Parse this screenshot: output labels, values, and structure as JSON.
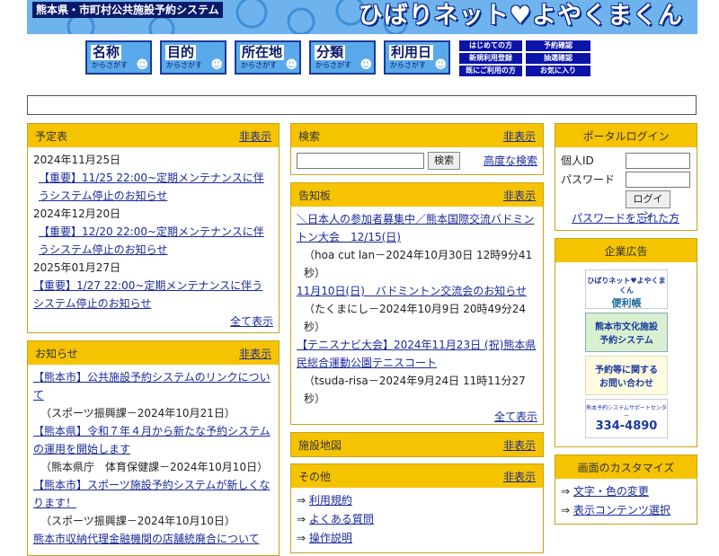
{
  "header": {
    "system_name": "熊本県・市町村公共施設予約システム",
    "brand": "ひばりネット♥よやくまくん",
    "search_buttons": [
      {
        "label": "名称",
        "sub": "からさがす"
      },
      {
        "label": "目的",
        "sub": "からさがす"
      },
      {
        "label": "所在地",
        "sub": "からさがす"
      },
      {
        "label": "分類",
        "sub": "からさがす"
      },
      {
        "label": "利用日",
        "sub": "からさがす"
      }
    ],
    "menu_buttons": [
      "はじめての方",
      "予約確認",
      "新規利用登録",
      "抽選確認",
      "既にご利用の方",
      "お気に入り"
    ]
  },
  "schedule": {
    "title": "予定表",
    "hide": "非表示",
    "entries": [
      {
        "date": "2024年11月25日",
        "text": "【重要】11/25 22:00~定期メンテナンスに伴うシステム停止のお知らせ"
      },
      {
        "date": "2024年12月20日",
        "text": "【重要】12/20 22:00~定期メンテナンスに伴うシステム停止のお知らせ"
      },
      {
        "date": "2025年01月27日",
        "text": "【重要】1/27 22:00~定期メンテナンスに伴うシステム停止のお知らせ"
      }
    ],
    "show_all": "全て表示"
  },
  "notices": {
    "title": "お知らせ",
    "hide": "非表示",
    "items": [
      {
        "text": "【熊本市】公共施設予約システムのリンクについて",
        "meta": "（スポーツ振興課－2024年10月21日）"
      },
      {
        "text": "【熊本県】令和７年４月から新たな予約システムの運用を開始します",
        "meta": "（熊本県庁　体育保健課－2024年10月10日）"
      },
      {
        "text": "【熊本市】スポーツ施設予約システムが新しくなります！",
        "meta": "（スポーツ振興課－2024年10月10日）"
      },
      {
        "text": "熊本市収納代理金融機関の店舗統廃合について",
        "meta": ""
      }
    ]
  },
  "search": {
    "title": "検索",
    "hide": "非表示",
    "button": "検索",
    "advanced": "高度な検索"
  },
  "board": {
    "title": "告知板",
    "hide": "非表示",
    "items": [
      {
        "text": "＼日本人の参加者募集中／熊本国際交流バドミントン大会　12/15(日)",
        "meta": "（hoa cut lan－2024年10月30日 12時9分41秒）"
      },
      {
        "text": "11月10日(日)　バドミントン交流会のお知らせ",
        "meta": "（たくまにし－2024年10月9日 20時49分24秒）"
      },
      {
        "text": "【テニスナビ大会】2024年11月23日 (祝)熊本県民総合運動公園テニスコート",
        "meta": "（tsuda-risa－2024年9月24日 11時11分27秒）"
      }
    ],
    "show_all": "全て表示"
  },
  "facility_map": {
    "title": "施設地図",
    "hide": "非表示"
  },
  "others": {
    "title": "その他",
    "hide": "非表示",
    "links": [
      "利用規約",
      "よくある質問",
      "操作説明"
    ]
  },
  "login": {
    "title": "ポータルログイン",
    "id_label": "個人ID",
    "password_label": "パスワード",
    "button": "ログイン",
    "forgot": "パスワードを忘れた方"
  },
  "ads": {
    "title": "企業広告",
    "banners": [
      {
        "line1": "ひばりネット♥よやくまくん",
        "line2": "便利帳"
      },
      {
        "line1": "熊本市文化施設",
        "line2": "予約システム"
      },
      {
        "line1": "予約等に関する",
        "line2": "お問い合わせ"
      },
      {
        "line1": "熊本予約システムサポートセンター",
        "line2": "334-4890"
      }
    ]
  },
  "customize": {
    "title": "画面のカスタマイズ",
    "links": [
      "文字・色の変更",
      "表示コンテンツ選択"
    ]
  }
}
